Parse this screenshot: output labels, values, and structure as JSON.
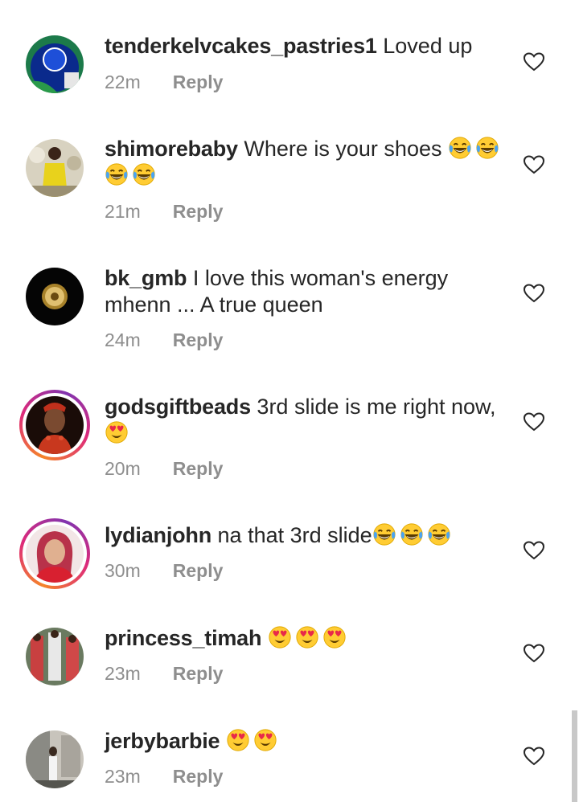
{
  "comments": [
    {
      "username": "tenderkelvcakes_pastries1",
      "text": "Loved up",
      "time": "22m",
      "reply": "Reply"
    },
    {
      "username": "shimorebaby",
      "text": "Where is your shoes",
      "time": "21m",
      "reply": "Reply"
    },
    {
      "username": "bk_gmb",
      "text": "I love this woman's energy mhenn ... A true queen",
      "time": "24m",
      "reply": "Reply"
    },
    {
      "username": "godsgiftbeads",
      "text": "3rd slide is me right now,",
      "time": "20m",
      "reply": "Reply"
    },
    {
      "username": "lydianjohn",
      "text": "na that 3rd slide",
      "time": "30m",
      "reply": "Reply"
    },
    {
      "username": "princess_timah",
      "text": "",
      "time": "23m",
      "reply": "Reply"
    },
    {
      "username": "jerbybarbie",
      "text": "",
      "time": "23m",
      "reply": "Reply"
    }
  ],
  "icons": {
    "like": "heart-outline-icon",
    "laugh": "face-with-tears-of-joy-emoji",
    "love": "smiling-face-with-heart-eyes-emoji"
  },
  "colors": {
    "text": "#262626",
    "meta": "#8e8e8e",
    "story_ring": "#dd2a7b"
  }
}
